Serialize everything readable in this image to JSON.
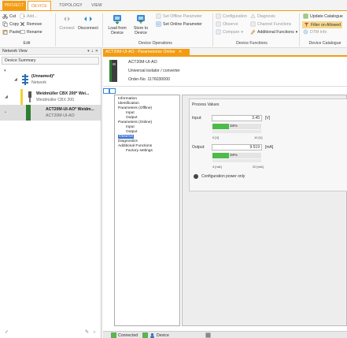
{
  "tabs": [
    {
      "label": "PROJECT"
    },
    {
      "label": "DEVICE"
    },
    {
      "label": "TOPOLOGY"
    },
    {
      "label": "VIEW"
    }
  ],
  "ribbon": {
    "edit": {
      "cut": "Cut",
      "copy": "Copy",
      "paste": "Paste",
      "add": "Add...",
      "remove": "Remove",
      "rename": "Rename",
      "label": "Edit"
    },
    "view_connection": {
      "connect": "Connect",
      "disconnect": "Disconnect"
    },
    "device_operations": {
      "load": "Load from Device",
      "store": "Store to Device",
      "set_offline": "Set Offline Parameter",
      "set_online": "Set Online Parameter",
      "label": "Device Operations"
    },
    "device_functions": {
      "configuration": "Configuration",
      "diagnosis": "Diagnosis",
      "observe": "Observe",
      "channel_functions": "Channel Functions",
      "compare": "Compare",
      "additional_functions": "Additional Functions",
      "label": "Device Functions"
    },
    "device_catalogue": {
      "update": "Update Catalogue",
      "filter": "Filter on Allowed",
      "dtm_info": "DTM Info",
      "label": "Device Catalogue"
    }
  },
  "network_view": {
    "title": "Network View",
    "controls": "▾ &#x2C7; ×",
    "device_summary": "Device Summary",
    "nodes": [
      {
        "title": "(Unnamed)*",
        "sub": "Network"
      },
      {
        "title": "Weidmüller CBX 200* Wei...",
        "sub": "Weidmüller CBX 200"
      },
      {
        "title": "ACT20M-UI-AO* Weidm...",
        "sub": "ACT20M-UI-AO"
      }
    ]
  },
  "document": {
    "tab_title": "ACT20M-UI-AO - Parameterize Online",
    "device_name": "ACT20M-UI-AO",
    "device_desc": "Universal isolator / converter",
    "order_no": "Order-No. 1176030000"
  },
  "nav_tree": [
    "Information",
    "Identification",
    "Parameters (Offline)",
    "Input",
    "Output",
    "Parameters (Online)",
    "Input",
    "Output",
    "Observe",
    "Diagnostics",
    "Additional Functions",
    "Factory settings"
  ],
  "process_values": {
    "title": "Process Values",
    "input": {
      "label": "Input:",
      "value": "3.45",
      "unit": "[V]",
      "percent_label": "34%",
      "percent": 0.34,
      "scale_min": "0 [V]",
      "scale_max": "10 [V]"
    },
    "output": {
      "label": "Output:",
      "value": "9.519",
      "unit": "[mA]",
      "percent_label": "34%",
      "percent": 0.34,
      "scale_min": "4 [mA]",
      "scale_max": "20 [mA]"
    },
    "config_power": "Configuration power only"
  },
  "status_bar": {
    "connected": "Connected",
    "device": "Device"
  }
}
